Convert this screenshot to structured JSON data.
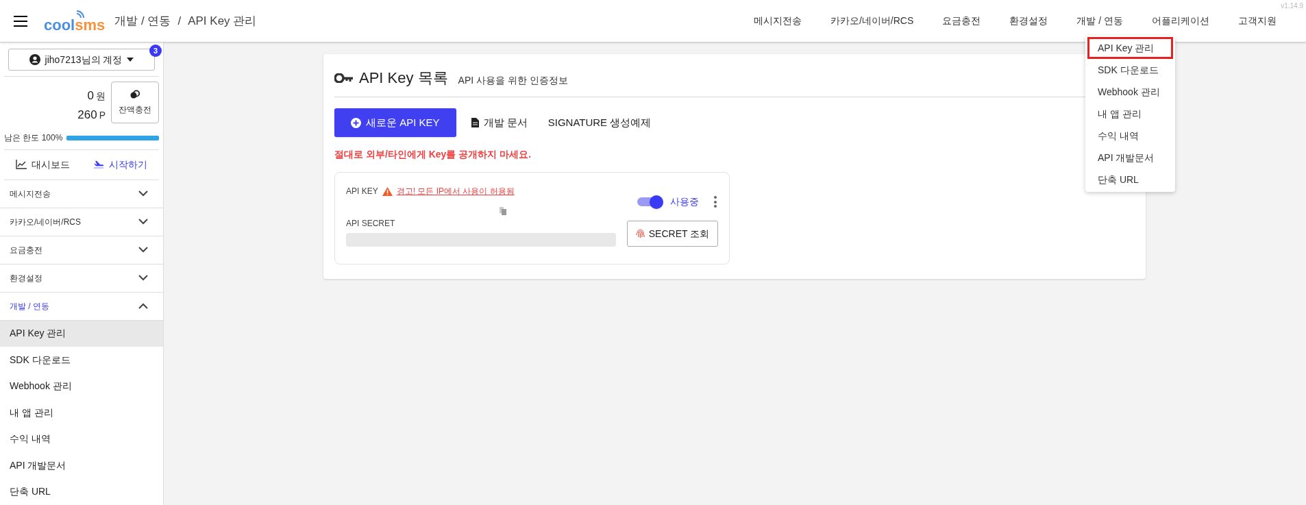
{
  "version": "v1.14.9",
  "logo": {
    "part_1": "cool",
    "part_2": "sms"
  },
  "breadcrumb": {
    "items": [
      "개발 / 연동",
      "API Key 관리"
    ],
    "separator": "/"
  },
  "top_nav": [
    "메시지전송",
    "카카오/네이버/RCS",
    "요금충전",
    "환경설정",
    "개발 / 연동",
    "어플리케이션",
    "고객지원"
  ],
  "dropdown": [
    {
      "label": "API Key 관리",
      "selected": true
    },
    {
      "label": "SDK 다운로드",
      "selected": false
    },
    {
      "label": "Webhook 관리",
      "selected": false
    },
    {
      "label": "내 앱 관리",
      "selected": false
    },
    {
      "label": "수익 내역",
      "selected": false
    },
    {
      "label": "API 개발문서",
      "selected": false
    },
    {
      "label": "단축 URL",
      "selected": false
    }
  ],
  "sidebar": {
    "account": "jiho7213님의 계정",
    "badge": "3",
    "cash": "0",
    "cash_unit": "원",
    "points": "260",
    "points_unit": "P",
    "charge_button": "잔액충전",
    "limit": {
      "label": "남은 한도 100%",
      "level": 1.0
    },
    "dashboard": "대시보드",
    "start": "시작하기",
    "sections": [
      {
        "label": "메시지전송",
        "expanded": false
      },
      {
        "label": "카카오/네이버/RCS",
        "expanded": false
      },
      {
        "label": "요금충전",
        "expanded": false
      },
      {
        "label": "환경설정",
        "expanded": false
      },
      {
        "label": "개발 / 연동",
        "expanded": true,
        "children": [
          {
            "label": "API Key 관리",
            "selected": true
          },
          {
            "label": "SDK 다운로드",
            "selected": false
          },
          {
            "label": "Webhook 관리",
            "selected": false
          },
          {
            "label": "내 앱 관리",
            "selected": false
          },
          {
            "label": "수익 내역",
            "selected": false
          },
          {
            "label": "API 개발문서",
            "selected": false
          },
          {
            "label": "단축 URL",
            "selected": false
          }
        ]
      }
    ]
  },
  "main": {
    "title": "API Key 목록",
    "subtitle": "API 사용을 위한 인증정보",
    "new_key_button": "새로운 API KEY",
    "docs_link": "개발 문서",
    "signature_link": "SIGNATURE 생성예제",
    "warning": "절대로 외부/타인에게 Key를 공개하지 마세요.",
    "key_card": {
      "key_label": "API KEY",
      "ip_warning": "경고! 모든 IP에서 사용이 허용됨",
      "enabled": true,
      "status": "사용중",
      "secret_label": "API SECRET",
      "secret_button": "SECRET 조회"
    }
  }
}
